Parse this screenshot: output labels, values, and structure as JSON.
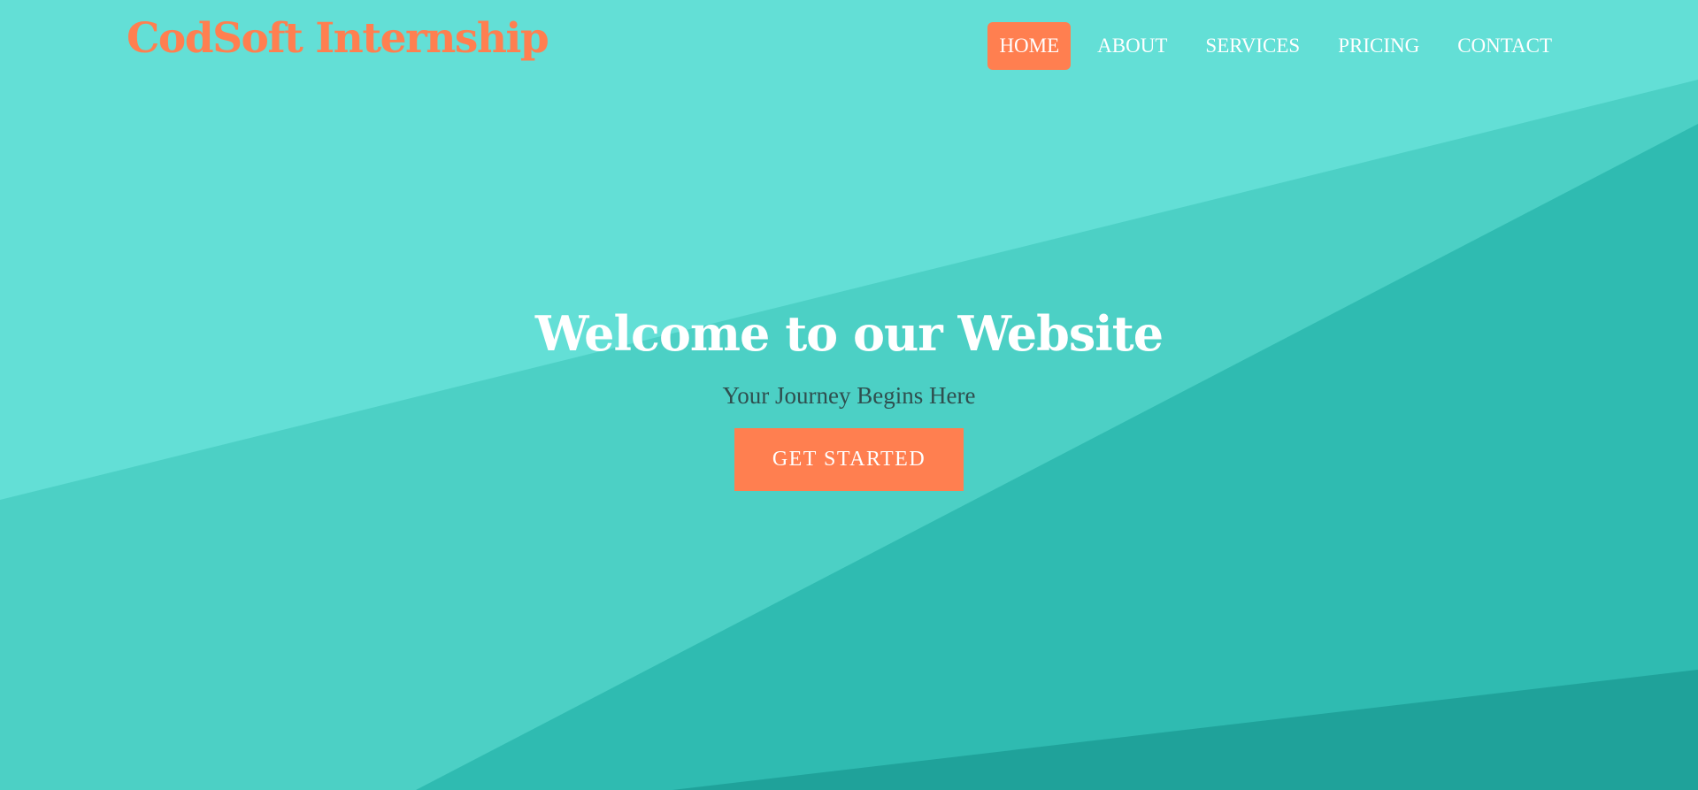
{
  "header": {
    "logo_text": "CodSoft Internship"
  },
  "nav": {
    "items": [
      {
        "label": "HOME",
        "active": true
      },
      {
        "label": "ABOUT",
        "active": false
      },
      {
        "label": "SERVICES",
        "active": false
      },
      {
        "label": "PRICING",
        "active": false
      },
      {
        "label": "CONTACT",
        "active": false
      }
    ]
  },
  "hero": {
    "title": "Welcome to our Website",
    "subtitle": "Your Journey Begins Here",
    "cta_label": "GET STARTED"
  },
  "colors": {
    "accent": "#ff7f50",
    "background_light": "#63dfd6",
    "background_mid": "#4dd1c6",
    "background_dark": "#2fbbb2",
    "background_darkest": "#1e9e96",
    "text_light": "#ffffff",
    "subtitle_text": "#2f4f4f"
  }
}
